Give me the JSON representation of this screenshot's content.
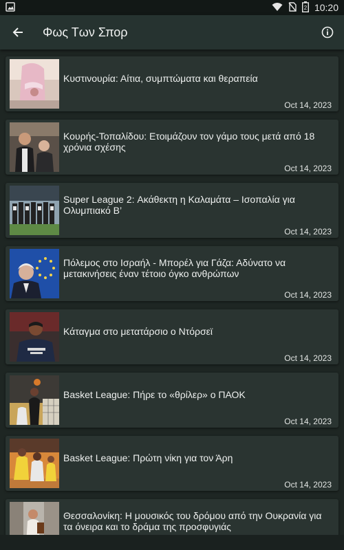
{
  "status_bar": {
    "time": "10:20",
    "battery_level": "2"
  },
  "app_bar": {
    "title": "Φως Των Σπορ"
  },
  "articles": [
    {
      "title": "Κυστινουρία: Αίτια, συμπτώματα και θεραπεία",
      "date": "Oct 14, 2023"
    },
    {
      "title": "Κουρής-Τοπαλίδου: Ετοιμάζουν τον γάμο τους μετά από 18 χρόνια σχέσης",
      "date": "Oct 14, 2023"
    },
    {
      "title": "Super League 2: Ακάθεκτη η Καλαμάτα – Ισοπαλία για Ολυμπιακό Β’",
      "date": "Oct 14, 2023"
    },
    {
      "title": "Πόλεμος στο Ισραήλ - Μπορέλ για Γάζα: Αδύνατο να μετακινήσεις έναν τέτοιο όγκο ανθρώπων",
      "date": "Oct 14, 2023"
    },
    {
      "title": "Κάταγμα στο μετατάρσιο ο Ντόρσεϊ",
      "date": "Oct 14, 2023"
    },
    {
      "title": "Basket League: Πήρε το «θρίλερ» ο ΠΑΟΚ",
      "date": "Oct 14, 2023"
    },
    {
      "title": "Basket League: Πρώτη νίκη για τον Άρη",
      "date": "Oct 14, 2023"
    },
    {
      "title": "Θεσσαλονίκη: Η μουσικός του δρόμου από την Ουκρανία για τα όνειρα και το δράμα της προσφυγιάς",
      "date": ""
    }
  ]
}
